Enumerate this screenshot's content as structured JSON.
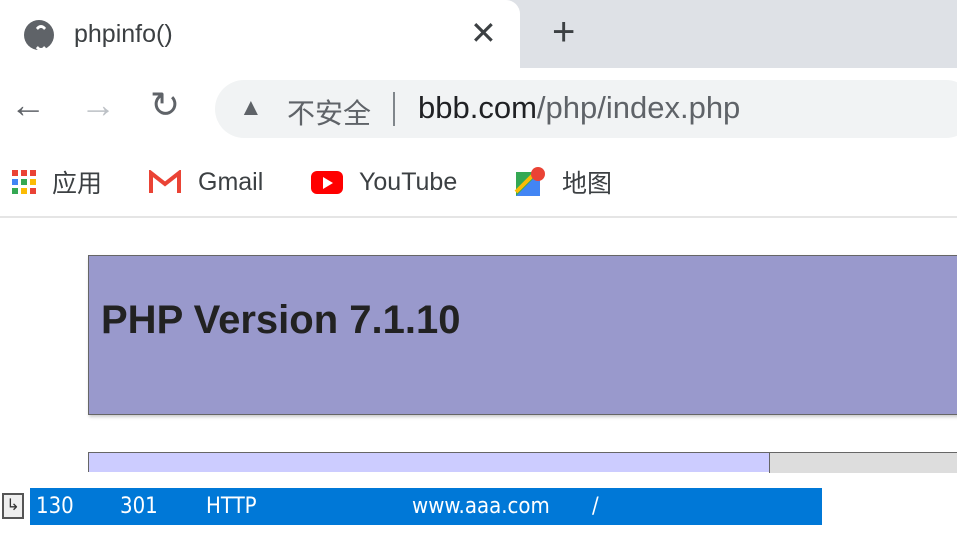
{
  "tab": {
    "title": "phpinfo()",
    "icon": "globe-icon"
  },
  "toolbar": {
    "insecure_label": "不安全",
    "url_host": "bbb.com",
    "url_path": "/php/index.php"
  },
  "bookmarks": [
    {
      "label": "应用",
      "icon": "apps-icon"
    },
    {
      "label": "Gmail",
      "icon": "gmail-icon"
    },
    {
      "label": "YouTube",
      "icon": "youtube-icon"
    },
    {
      "label": "地图",
      "icon": "maps-icon"
    }
  ],
  "page": {
    "heading": "PHP Version 7.1.10",
    "header_color": "#9999cc"
  },
  "capture_row": {
    "id": "130",
    "status": "301",
    "protocol": "HTTP",
    "host": "www.aaa.com",
    "path": "/",
    "highlight_color": "#0078d7"
  }
}
